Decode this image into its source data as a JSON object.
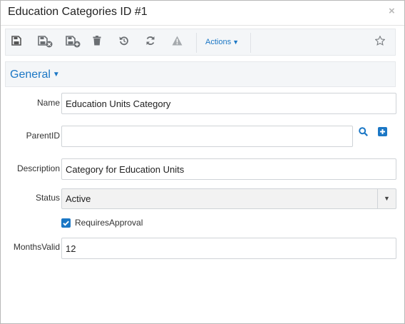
{
  "dialog": {
    "title": "Education Categories ID #1",
    "close_glyph": "×"
  },
  "toolbar": {
    "buttons": [
      {
        "name": "save-icon"
      },
      {
        "name": "save-and-close-icon"
      },
      {
        "name": "save-and-new-icon"
      },
      {
        "name": "delete-icon"
      },
      {
        "name": "undo-icon"
      },
      {
        "name": "refresh-icon"
      },
      {
        "name": "warning-icon"
      }
    ],
    "actions_label": "Actions",
    "actions_caret": "▼",
    "favorite_icon": "star-icon"
  },
  "section": {
    "title": "General",
    "caret": "▼"
  },
  "form": {
    "name": {
      "label": "Name",
      "value": "Education Units Category"
    },
    "parent_id": {
      "label": "ParentID",
      "value": "",
      "search_icon": "search-icon",
      "add_icon": "plus-square-icon"
    },
    "description": {
      "label": "Description",
      "value": "Category for Education Units"
    },
    "status": {
      "label": "Status",
      "value": "Active",
      "arrow": "▼"
    },
    "requires_approval": {
      "label": "RequiresApproval",
      "checked": true
    },
    "months_valid": {
      "label": "MonthsValid",
      "value": "12"
    }
  },
  "colors": {
    "accent": "#1b77c5",
    "toolbar_bg": "#f4f6f8",
    "icon_gray": "#6b6f73"
  }
}
